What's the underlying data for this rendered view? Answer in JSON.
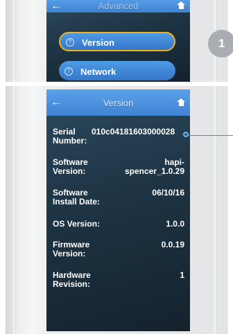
{
  "step": "1",
  "advanced_screen": {
    "title": "Advanced",
    "back_icon": "back-arrow-icon",
    "home_icon": "home-icon",
    "menu_items": [
      {
        "label": "Version",
        "icon": "info-icon",
        "highlighted": true
      },
      {
        "label": "Network",
        "icon": "info-icon",
        "highlighted": false
      }
    ],
    "highlight_color": "#f0b21a"
  },
  "version_screen": {
    "title": "Version",
    "back_icon": "back-arrow-icon",
    "home_icon": "home-icon",
    "rows": [
      {
        "label_line1": "Serial",
        "label_line2": "Number:",
        "value_line1": "010c04181603000028",
        "value_line2": ""
      },
      {
        "label_line1": "Software",
        "label_line2": "Version:",
        "value_line1": "hapi-",
        "value_line2": "spencer_1.0.29"
      },
      {
        "label_line1": "Software",
        "label_line2": "Install Date:",
        "value_line1": "06/10/16",
        "value_line2": ""
      },
      {
        "label_line1": "OS Version:",
        "label_line2": "",
        "value_line1": "1.0.0",
        "value_line2": ""
      },
      {
        "label_line1": "Firmware",
        "label_line2": "Version:",
        "value_line1": "0.0.19",
        "value_line2": ""
      },
      {
        "label_line1": "Hardware",
        "label_line2": "Revision:",
        "value_line1": "1",
        "value_line2": ""
      }
    ]
  },
  "colors": {
    "header_blue": "#4a92e0",
    "screen_dark": "#1e3444",
    "callout": "#3a8fd0"
  }
}
